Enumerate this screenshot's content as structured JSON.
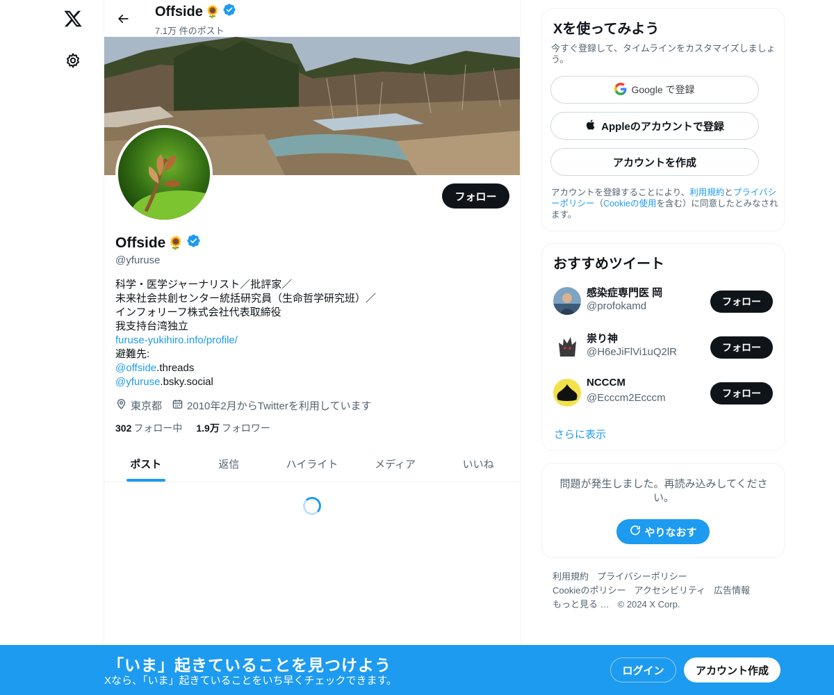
{
  "nav": {
    "logo_icon": "x-logo-icon",
    "settings_icon": "gear-icon"
  },
  "header": {
    "name": "Offside",
    "name_emoji": "🌻",
    "post_count": "7.1万 件のポスト"
  },
  "profile": {
    "name": "Offside",
    "name_emoji": "🌻",
    "handle": "@yfuruse",
    "follow_label": "フォロー",
    "bio": {
      "line1": "科学・医学ジャーナリスト／批評家／",
      "line2": "未来社会共創センター統括研究員（生命哲学研究班）／",
      "line3": "インフォリーフ株式会社代表取締役",
      "line4": "我支持台湾独立",
      "link": "furuse-yukihiro.info/profile/",
      "line6": "避難先:",
      "mention1": "@offside",
      "mention1_suffix": ".threads",
      "mention2": "@yfuruse",
      "mention2_suffix": ".bsky.social"
    },
    "location": "東京都",
    "joined": "2010年2月からTwitterを利用しています",
    "following_count": "302",
    "following_label": "フォロー中",
    "followers_count": "1.9万",
    "followers_label": "フォロワー"
  },
  "tabs": [
    "ポスト",
    "返信",
    "ハイライト",
    "メディア",
    "いいね"
  ],
  "signup_card": {
    "title": "Xを使ってみよう",
    "subtitle": "今すぐ登録して、タイムラインをカスタマイズしましょう。",
    "google_label": "Google で登録",
    "apple_label": "Appleのアカウントで登録",
    "create_label": "アカウントを作成",
    "legal_prefix": "アカウントを登録することにより、",
    "legal_terms": "利用規約",
    "legal_and": "と",
    "legal_privacy": "プライバシーポリシー",
    "legal_paren_open": "（",
    "legal_cookie": "Cookieの使用",
    "legal_suffix": "を含む）に同意したとみなされます。"
  },
  "recommended": {
    "title": "おすすめツイート",
    "users": [
      {
        "name": "感染症専門医 岡",
        "handle": "@profokamd",
        "button": "フォロー"
      },
      {
        "name": "祟り神",
        "handle": "@H6eJiFlVi1uQ2lR",
        "button": "フォロー"
      },
      {
        "name": "NCCCM",
        "handle": "@Ecccm2Ecccm",
        "button": "フォロー"
      }
    ],
    "more": "さらに表示"
  },
  "error_card": {
    "message": "問題が発生しました。再読み込みしてください。",
    "retry_label": "やりなおす"
  },
  "footer": {
    "terms": "利用規約",
    "privacy": "プライバシーポリシー",
    "cookie": "Cookieのポリシー",
    "accessibility": "アクセシビリティ",
    "ads": "広告情報",
    "more": "もっと見る …",
    "copyright": "© 2024 X Corp."
  },
  "bottom_bar": {
    "title": "「いま」起きていることを見つけよう",
    "subtitle": "Xなら、「いま」起きていることをいち早くチェックできます。",
    "login": "ログイン",
    "signup": "アカウント作成"
  },
  "colors": {
    "accent": "#1d9bf0",
    "text": "#0f1419",
    "muted": "#536471",
    "border": "#eff3f4"
  }
}
